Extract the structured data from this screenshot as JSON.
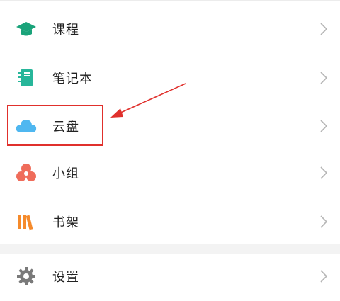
{
  "menu": {
    "items": [
      {
        "label": "课程",
        "icon": "graduation-cap-icon",
        "color": "#1aa37a"
      },
      {
        "label": "笔记本",
        "icon": "notebook-icon",
        "color": "#27b69a"
      },
      {
        "label": "云盘",
        "icon": "cloud-icon",
        "color": "#4fb7f0"
      },
      {
        "label": "小组",
        "icon": "group-icon",
        "color": "#ef6c5a"
      },
      {
        "label": "书架",
        "icon": "bookshelf-icon",
        "color": "#f58a2b"
      }
    ],
    "settings": {
      "label": "设置",
      "icon": "gear-icon",
      "color": "#7a7a7a"
    }
  },
  "annotation": {
    "color": "#e0302c",
    "highlight_target": "云盘"
  }
}
